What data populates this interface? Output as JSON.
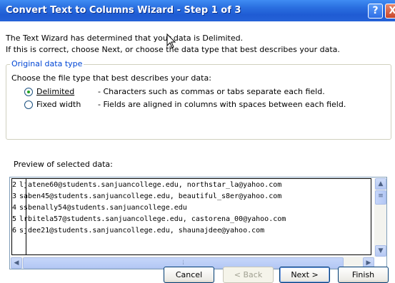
{
  "window": {
    "title": "Convert Text to Columns Wizard - Step 1 of 3",
    "help_glyph": "?",
    "close_glyph": "X"
  },
  "intro": {
    "line1": "The Text Wizard has determined that your data is Delimited.",
    "line2": "If this is correct, choose Next, or choose the data type that best describes your data."
  },
  "original_data_type": {
    "legend": "Original data type",
    "prompt": "Choose the file type that best describes your data:",
    "options": [
      {
        "label": "Delimited",
        "description": "- Characters such as commas or tabs separate each field.",
        "selected": true
      },
      {
        "label": "Fixed width",
        "description": "- Fields are aligned in columns with spaces between each field.",
        "selected": false
      }
    ]
  },
  "preview": {
    "label": "Preview of selected data:",
    "rows": [
      {
        "num": "2",
        "text": "ljatene60@students.sanjuancollege.edu, northstar_la@yahoo.com"
      },
      {
        "num": "3",
        "text": "saben45@students.sanjuancollege.edu, beautiful_s8er@yahoo.com"
      },
      {
        "num": "4",
        "text": "ssbenally54@students.sanjuancollege.edu"
      },
      {
        "num": "5",
        "text": "lrbitela57@students.sanjuancollege.edu, castorena_00@yahoo.com"
      },
      {
        "num": "6",
        "text": "sjdee21@students.sanjuancollege.edu, shaunajdee@yahoo.com"
      }
    ]
  },
  "buttons": {
    "cancel": "Cancel",
    "back": "< Back",
    "next": "Next >",
    "finish": "Finish"
  },
  "colors": {
    "title_bar": "#2563d8",
    "group_legend": "#0046d5",
    "radio_selected": "#21a121"
  }
}
